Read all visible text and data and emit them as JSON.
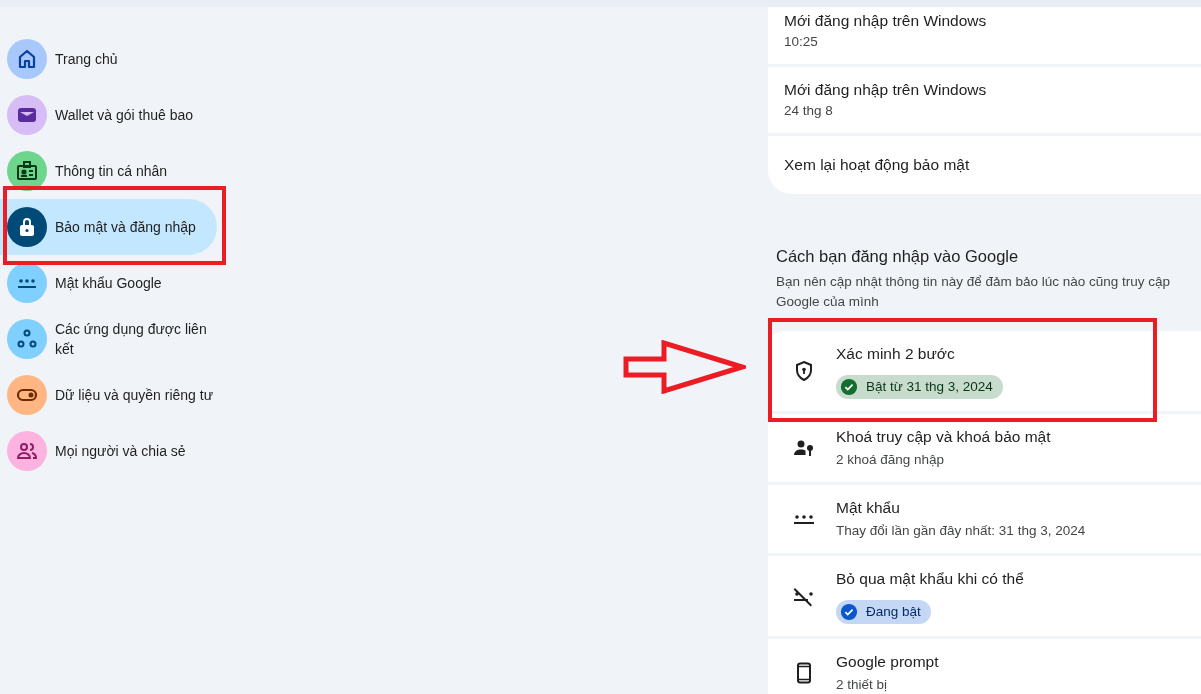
{
  "sidebar": {
    "items": [
      {
        "label": "Trang chủ",
        "kind": "home",
        "selected": false,
        "annotated": false
      },
      {
        "label": "Wallet và gói thuê bao",
        "kind": "wallet",
        "selected": false,
        "annotated": false
      },
      {
        "label": "Thông tin cá nhân",
        "kind": "id",
        "selected": false,
        "annotated": false
      },
      {
        "label": "Bảo mật và đăng nhập",
        "kind": "lock",
        "selected": true,
        "annotated": true
      },
      {
        "label": "Mật khẩu Google",
        "kind": "password",
        "selected": false,
        "annotated": false
      },
      {
        "label": "Các ứng dụng được liên kết",
        "kind": "apps",
        "selected": false,
        "annotated": false
      },
      {
        "label": "Dữ liệu và quyền riêng tư",
        "kind": "toggle",
        "selected": false,
        "annotated": false
      },
      {
        "label": "Mọi người và chia sẻ",
        "kind": "people",
        "selected": false,
        "annotated": false
      }
    ]
  },
  "activity": [
    {
      "title": "Mới đăng nhập trên Windows",
      "subtitle": "10:25"
    },
    {
      "title": "Mới đăng nhập trên Windows",
      "subtitle": "24 thg 8"
    },
    {
      "title": "Xem lại hoạt động bảo mật"
    }
  ],
  "signin": {
    "title": "Cách bạn đăng nhập vào Google",
    "description": [
      "Bạn nên cập nhật thông tin này để đảm bảo lúc nào cũng truy cập",
      "Google của mình"
    ],
    "methods": [
      {
        "title": "Xác minh 2 bước",
        "kind": "shield",
        "status": {
          "label": "Bật từ 31 thg 3, 2024",
          "color": "#146c2e"
        },
        "annotated": true
      },
      {
        "title": "Khoá truy cập và khoá bảo mật",
        "kind": "passkey",
        "subtitle": "2 khoá đăng nhập",
        "annotated": false
      },
      {
        "title": "Mật khẩu",
        "kind": "password",
        "subtitle": "Thay đổi lần gần đây nhất: 31 thg 3, 2024",
        "annotated": false
      },
      {
        "title": "Bỏ qua mật khẩu khi có thể",
        "kind": "skip",
        "status": {
          "label": "Đang bật",
          "color": "#0b57d0"
        },
        "annotated": false
      },
      {
        "title": "Google prompt",
        "kind": "phone",
        "subtitle": "2 thiết bị",
        "annotated": false
      }
    ]
  }
}
